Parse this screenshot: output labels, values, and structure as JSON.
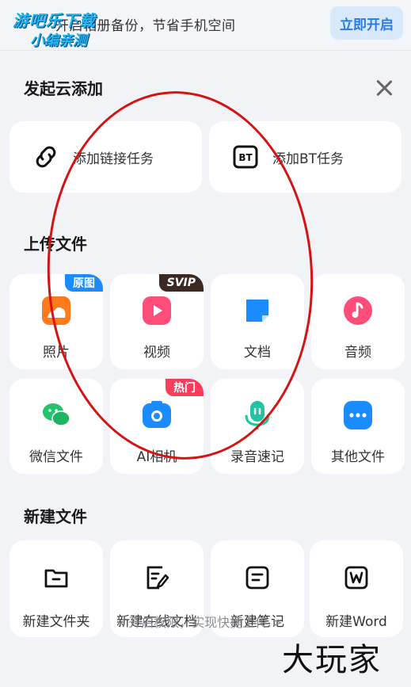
{
  "banner": {
    "text": "开启相册备份，节省手机空间",
    "button": "立即开启"
  },
  "watermark_top": {
    "line1": "游吧乐下载",
    "line2": "小编亲测"
  },
  "sheet": {
    "title": "发起云添加",
    "add_tasks": [
      {
        "label": "添加链接任务",
        "icon": "link-icon"
      },
      {
        "label": "添加BT任务",
        "icon": "bt-icon"
      }
    ],
    "upload": {
      "title": "上传文件",
      "items": [
        {
          "label": "照片",
          "icon": "photo-icon",
          "badge": "原图",
          "color": "#ff7a1a"
        },
        {
          "label": "视频",
          "icon": "video-icon",
          "badge": "SVIP",
          "color": "#ff4d7a"
        },
        {
          "label": "文档",
          "icon": "document-icon",
          "badge": "",
          "color": "#1a8cff"
        },
        {
          "label": "音频",
          "icon": "audio-icon",
          "badge": "",
          "color": "#ff4d7a"
        },
        {
          "label": "微信文件",
          "icon": "wechat-icon",
          "badge": "",
          "color": "#22c36b"
        },
        {
          "label": "AI相机",
          "icon": "camera-icon",
          "badge": "热门",
          "color": "#1a8cff"
        },
        {
          "label": "录音速记",
          "icon": "microphone-icon",
          "badge": "",
          "color": "#22c3a0"
        },
        {
          "label": "其他文件",
          "icon": "more-icon",
          "badge": "",
          "color": "#1a8cff"
        }
      ]
    },
    "create": {
      "title": "新建文件",
      "items": [
        {
          "label": "新建文件夹",
          "icon": "folder-icon"
        },
        {
          "label": "新建在线文档",
          "icon": "online-doc-icon"
        },
        {
          "label": "新建笔记",
          "icon": "note-icon"
        },
        {
          "label": "新建Word",
          "icon": "word-icon"
        }
      ]
    },
    "footer": "开启权限，实现快捷上传 >"
  },
  "watermark_bottom": "大玩家",
  "colors": {
    "accent": "#2a7be4",
    "hot_badge": "#ff3b5c",
    "svip_badge": "#3a2a22",
    "origin_badge": "#1a8cff"
  }
}
